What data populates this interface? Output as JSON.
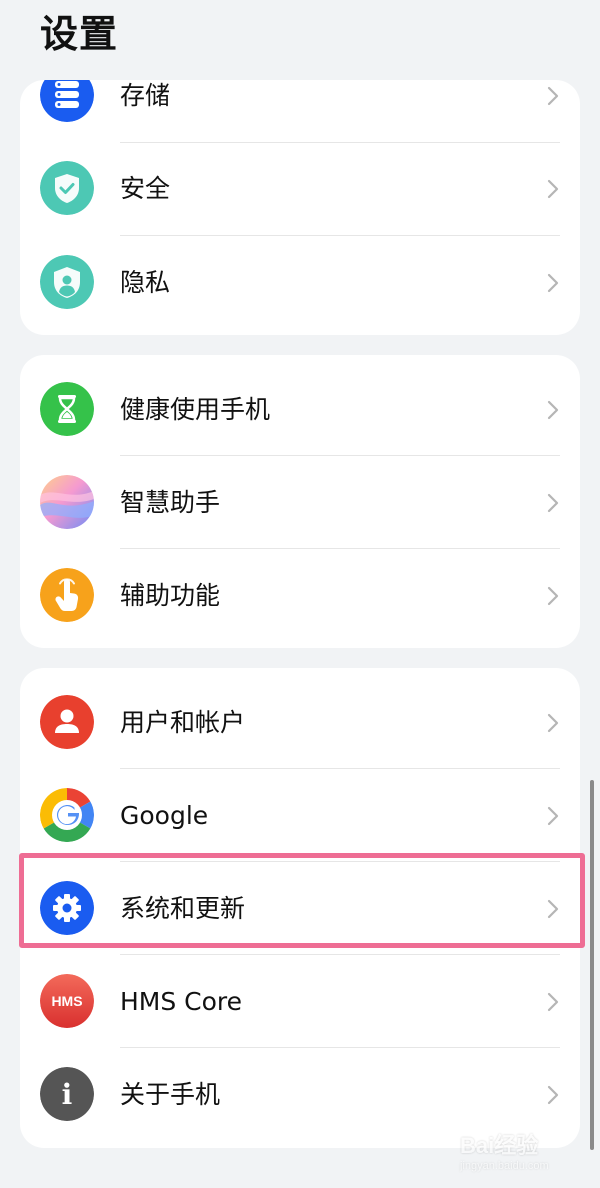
{
  "header": {
    "title": "设置"
  },
  "groups": [
    {
      "items": [
        {
          "label": "存储",
          "icon": "storage-icon",
          "color": "#1a5cf0"
        },
        {
          "label": "安全",
          "icon": "security-shield-icon",
          "color": "#4dc8b4"
        },
        {
          "label": "隐私",
          "icon": "privacy-shield-icon",
          "color": "#4dc8b4"
        }
      ]
    },
    {
      "items": [
        {
          "label": "健康使用手机",
          "icon": "hourglass-icon",
          "color": "#35c24a"
        },
        {
          "label": "智慧助手",
          "icon": "smart-assistant-icon",
          "color": "#b48cf0"
        },
        {
          "label": "辅助功能",
          "icon": "accessibility-hand-icon",
          "color": "#f7a21b"
        }
      ]
    },
    {
      "items": [
        {
          "label": "用户和帐户",
          "icon": "user-icon",
          "color": "#e8402e"
        },
        {
          "label": "Google",
          "icon": "google-icon",
          "color": "#4285f4"
        },
        {
          "label": "系统和更新",
          "icon": "gear-icon",
          "color": "#1a5cf0",
          "highlighted": true
        },
        {
          "label": "HMS Core",
          "icon": "hms-core-icon",
          "color": "#e8403c",
          "icon_text": "HMS"
        },
        {
          "label": "关于手机",
          "icon": "info-icon",
          "color": "#555555",
          "icon_text": "i"
        }
      ]
    }
  ],
  "highlight_color": "#ee6d94",
  "watermark": {
    "text": "Bai经验",
    "sub": "jingyan.baidu.com"
  }
}
